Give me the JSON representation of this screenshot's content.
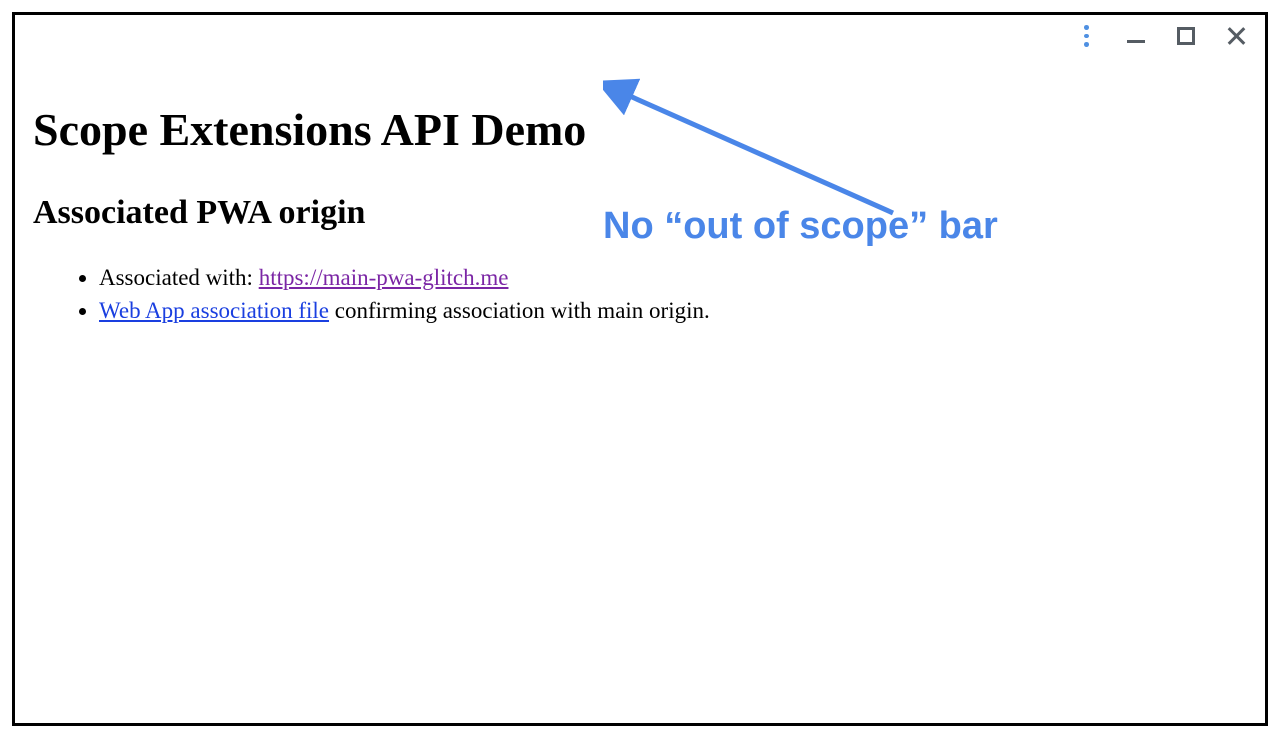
{
  "window_controls": {
    "menu": "menu",
    "minimize": "minimize",
    "maximize": "maximize",
    "close": "close"
  },
  "page": {
    "title": "Scope Extensions API Demo",
    "subheading": "Associated PWA origin",
    "list": {
      "item1_prefix": "Associated with: ",
      "item1_link": "https://main-pwa-glitch.me",
      "item2_link": "Web App association file",
      "item2_suffix": " confirming association with main origin."
    }
  },
  "annotation": {
    "text": "No “out of scope” bar",
    "arrow_color": "#4a86e8"
  }
}
